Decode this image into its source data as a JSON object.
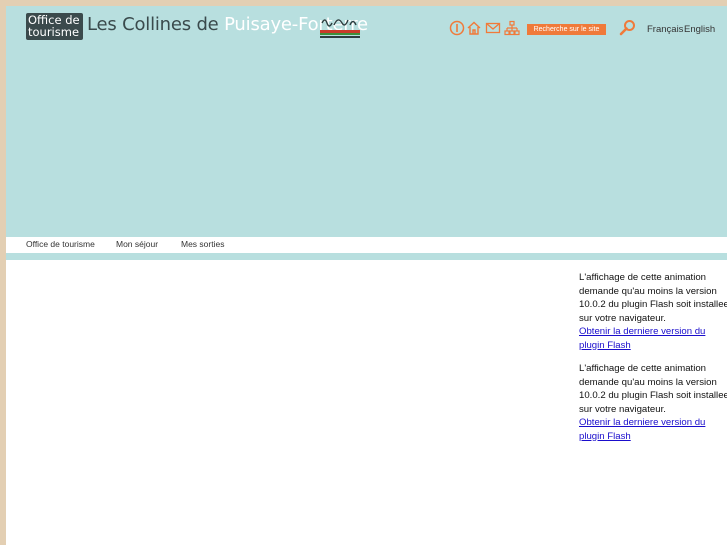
{
  "header": {
    "logo_line1": "Office de",
    "logo_line2": "tourisme",
    "title_dark": "Les Collines de",
    "title_light": "Puisaye-Forterre",
    "search_label": "Recherche sur le site",
    "lang_fr": "Français",
    "lang_en": "English"
  },
  "nav": {
    "items": [
      "Office de tourisme",
      "Mon séjour",
      "Mes sorties"
    ]
  },
  "flash": [
    {
      "message": "L'affichage de cette animation demande qu'au moins la version 10.0.2 du plugin Flash soit installee sur votre navigateur.",
      "link": "Obtenir la derniere version du plugin Flash"
    },
    {
      "message": "L'affichage de cette animation demande qu'au moins la version 10.0.2 du plugin Flash soit installee sur votre navigateur.",
      "link": "Obtenir la derniere version du plugin Flash"
    }
  ],
  "colors": {
    "accent": "#f07a3a",
    "header_bg": "#b8dfdf",
    "frame": "#e3cfb3"
  },
  "icons": [
    "info-icon",
    "home-icon",
    "mail-icon",
    "sitemap-icon",
    "search-icon"
  ]
}
